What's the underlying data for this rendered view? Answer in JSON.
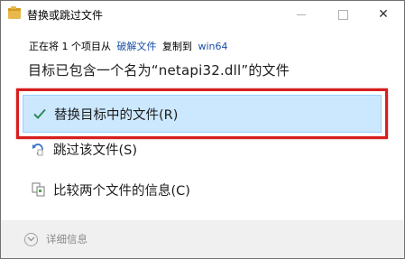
{
  "window": {
    "title": "替换或跳过文件",
    "close_glyph": "✕"
  },
  "copy_info": {
    "prefix": "正在将 1 个项目从",
    "source": "破解文件",
    "middle": "复制到",
    "destination": "win64"
  },
  "heading": "目标已包含一个名为“netapi32.dll”的文件",
  "options": {
    "replace_label": "替换目标中的文件(R)",
    "skip_label": "跳过该文件(S)",
    "compare_label": "比较两个文件的信息(C)"
  },
  "footer": {
    "details_label": "详细信息"
  },
  "colors": {
    "selected_bg": "#cce8ff",
    "highlight_border": "#d81e1e",
    "link": "#1a4fa8",
    "check": "#2e8b57"
  }
}
